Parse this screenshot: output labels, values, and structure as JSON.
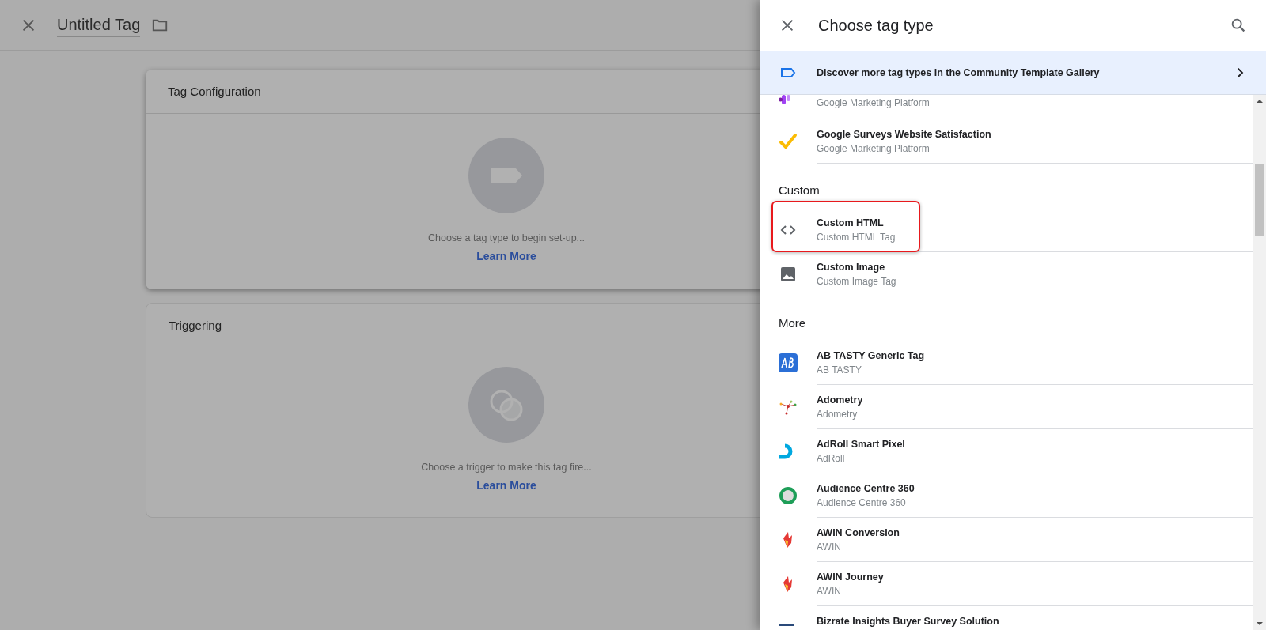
{
  "editor": {
    "title": "Untitled Tag",
    "cards": [
      {
        "title": "Tag Configuration",
        "hint": "Choose a tag type to begin set-up...",
        "link": "Learn More"
      },
      {
        "title": "Triggering",
        "hint": "Choose a trigger to make this tag fire...",
        "link": "Learn More"
      }
    ]
  },
  "panel": {
    "title": "Choose tag type",
    "banner": "Discover more tag types in the Community Template Gallery",
    "items": [
      {
        "kind": "partial",
        "subtitle": "Google Marketing Platform",
        "highlighted": false
      },
      {
        "kind": "item",
        "title": "Google Surveys Website Satisfaction",
        "subtitle": "Google Marketing Platform",
        "highlighted": false
      },
      {
        "kind": "header",
        "title": "Custom"
      },
      {
        "kind": "item",
        "title": "Custom HTML",
        "subtitle": "Custom HTML Tag",
        "highlighted": true
      },
      {
        "kind": "item",
        "title": "Custom Image",
        "subtitle": "Custom Image Tag",
        "highlighted": false
      },
      {
        "kind": "header",
        "title": "More"
      },
      {
        "kind": "item",
        "title": "AB TASTY Generic Tag",
        "subtitle": "AB TASTY",
        "highlighted": false
      },
      {
        "kind": "item",
        "title": "Adometry",
        "subtitle": "Adometry",
        "highlighted": false
      },
      {
        "kind": "item",
        "title": "AdRoll Smart Pixel",
        "subtitle": "AdRoll",
        "highlighted": false
      },
      {
        "kind": "item",
        "title": "Audience Centre 360",
        "subtitle": "Audience Centre 360",
        "highlighted": false
      },
      {
        "kind": "item",
        "title": "AWIN Conversion",
        "subtitle": "AWIN",
        "highlighted": false
      },
      {
        "kind": "item",
        "title": "AWIN Journey",
        "subtitle": "AWIN",
        "highlighted": false
      },
      {
        "kind": "item",
        "title": "Bizrate Insights Buyer Survey Solution",
        "highlighted": false
      }
    ]
  }
}
